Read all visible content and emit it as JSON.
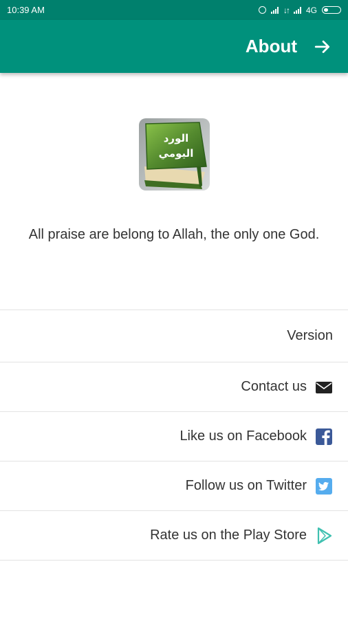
{
  "status_bar": {
    "time": "10:39 AM",
    "network": "4G"
  },
  "app_bar": {
    "title": "About"
  },
  "about": {
    "logo_text_line1": "الورد",
    "logo_text_line2": "اليومي",
    "description": "All praise are belong to Allah, the only one God."
  },
  "menu": {
    "version_label": "Version",
    "contact_label": "Contact us",
    "facebook_label": "Like us on Facebook",
    "twitter_label": "Follow us on Twitter",
    "rate_label": "Rate us on the Play Store"
  },
  "colors": {
    "status_bar": "#00806d",
    "app_bar": "#00917c",
    "facebook": "#3b5998",
    "twitter": "#55acee",
    "play": "#3fc0b0"
  }
}
